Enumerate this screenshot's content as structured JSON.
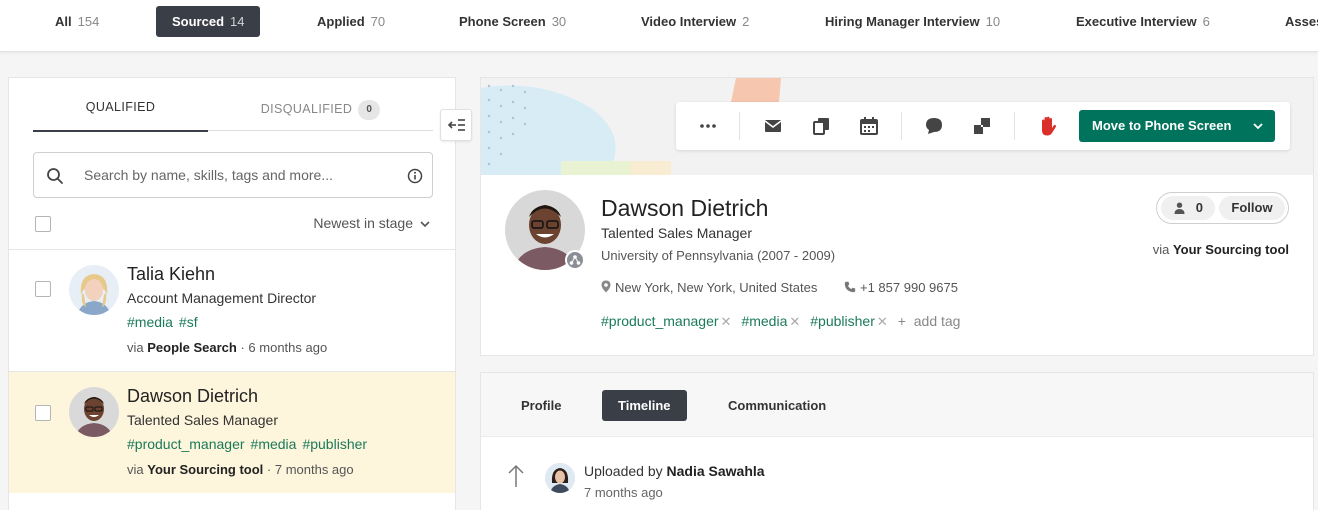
{
  "stages": [
    {
      "label": "All",
      "count": "154"
    },
    {
      "label": "Sourced",
      "count": "14"
    },
    {
      "label": "Applied",
      "count": "70"
    },
    {
      "label": "Phone Screen",
      "count": "30"
    },
    {
      "label": "Video Interview",
      "count": "2"
    },
    {
      "label": "Hiring Manager Interview",
      "count": "10"
    },
    {
      "label": "Executive Interview",
      "count": "6"
    },
    {
      "label": "Assessment",
      "count": ""
    }
  ],
  "left": {
    "tab_qualified": "QUALIFIED",
    "tab_disqualified": "DISQUALIFIED",
    "disqualified_count": "0",
    "search_placeholder": "Search by name, skills, tags and more...",
    "sort_label": "Newest in stage",
    "candidates": [
      {
        "name": "Talia Kiehn",
        "title": "Account Management Director",
        "tags": [
          "#media",
          "#sf"
        ],
        "via_prefix": "via",
        "source": "People Search",
        "time": "· 6 months ago"
      },
      {
        "name": "Dawson Dietrich",
        "title": "Talented Sales Manager",
        "tags": [
          "#product_manager",
          "#media",
          "#publisher"
        ],
        "via_prefix": "via",
        "source": "Your Sourcing tool",
        "time": "· 7 months ago"
      }
    ]
  },
  "profile": {
    "move_button": "Move to Phone Screen",
    "name": "Dawson Dietrich",
    "title": "Talented Sales Manager",
    "education": "University of Pennsylvania (2007 - 2009)",
    "location": "New York, New York, United States",
    "phone": "+1 857 990 9675",
    "tags": [
      "#product_manager",
      "#media",
      "#publisher"
    ],
    "add_tag": "add tag",
    "followers": "0",
    "follow_label": "Follow",
    "via_prefix": "via",
    "source": "Your Sourcing tool"
  },
  "timeline": {
    "tabs": [
      "Profile",
      "Timeline",
      "Communication"
    ],
    "active_tab": "Timeline",
    "entry_prefix": "Uploaded by",
    "entry_user": "Nadia Sawahla",
    "entry_time": "7 months ago"
  },
  "colors": {
    "accent_green": "#00735c",
    "tag_green": "#1a7a5a",
    "dark_tab": "#3a3f47",
    "selected_row": "#fdf5dc",
    "stop_hand": "#d9302c"
  }
}
